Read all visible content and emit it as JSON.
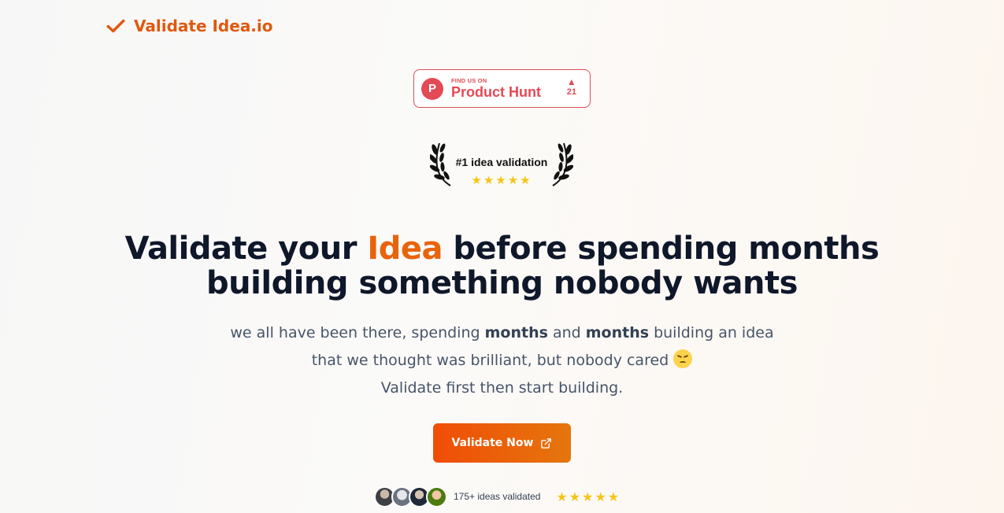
{
  "header": {
    "logo_icon": "checkmark-icon",
    "logo_text": "Validate Idea.io"
  },
  "product_hunt": {
    "small_text": "FIND US ON",
    "big_text": "Product Hunt",
    "logo_letter": "P",
    "upvote_icon": "triangle-up-icon",
    "votes": "21",
    "color": "#e34a55"
  },
  "award": {
    "text": "#1 idea validation",
    "stars": "★★★★★",
    "rating": 5
  },
  "hero": {
    "headline_part1": "Validate your ",
    "headline_accent": "Idea",
    "headline_part2": " before spending months",
    "headline_line2": "building something nobody wants",
    "sub_line1_a": "we all have been there, spending ",
    "sub_line1_b": "months",
    "sub_line1_c": " and ",
    "sub_line1_d": "months",
    "sub_line1_e": " building an idea",
    "sub_line2": "that we thought was brilliant, but nobody cared ",
    "sub_line2_emoji": "disappointed-face-icon",
    "sub_line3": "Validate first then start building."
  },
  "cta": {
    "label": "Validate Now",
    "icon": "external-link-icon"
  },
  "social_proof": {
    "text": "175+ ideas validated",
    "stars": "★★★★★",
    "rating": 5,
    "avatar_count": 4
  },
  "colors": {
    "accent": "#e8640c",
    "headline": "#0f172a",
    "star": "#f5c518",
    "cta_gradient_start": "#f04d07",
    "cta_gradient_end": "#e5760c"
  }
}
